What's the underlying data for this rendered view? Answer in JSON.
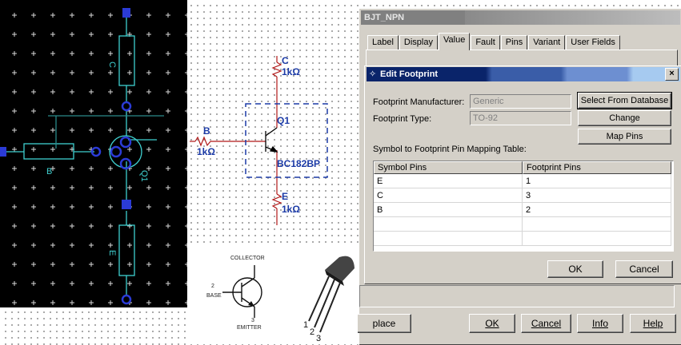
{
  "pcb": {
    "labels": [
      "C",
      "B",
      "Q1",
      "E"
    ]
  },
  "schematic": {
    "collector_name": "C",
    "collector_value": "1kΩ",
    "base_name": "B",
    "base_value": "1kΩ",
    "transistor_ref": "Q1",
    "transistor_part": "BC182BP",
    "emitter_name": "E",
    "emitter_value": "1kΩ"
  },
  "pinout": {
    "collector": "COLLECTOR",
    "base_num": "2",
    "base": "BASE",
    "emitter_num": "3",
    "emitter": "EMITTER",
    "pin_numbers": [
      "1",
      "2",
      "3"
    ]
  },
  "back_dialog": {
    "title": "BJT_NPN",
    "tabs": [
      {
        "label": "Label",
        "active": false
      },
      {
        "label": "Display",
        "active": false
      },
      {
        "label": "Value",
        "active": true
      },
      {
        "label": "Fault",
        "active": false
      },
      {
        "label": "Pins",
        "active": false
      },
      {
        "label": "Variant",
        "active": false
      },
      {
        "label": "User Fields",
        "active": false
      }
    ],
    "replace_partial": "place",
    "ok_label": "OK",
    "cancel_label": "Cancel",
    "info_label": "Info",
    "help_label": "Help"
  },
  "edit_footprint": {
    "title": "Edit Footprint",
    "close": "×",
    "manufacturer_label": "Footprint Manufacturer:",
    "manufacturer_value": "Generic",
    "type_label": "Footprint Type:",
    "type_value": "TO-92",
    "select_db_label": "Select From Database",
    "change_label": "Change",
    "map_pins_label": "Map Pins",
    "table_label": "Symbol to Footprint Pin Mapping Table:",
    "table": {
      "columns": [
        "Symbol Pins",
        "Footprint Pins"
      ],
      "rows": [
        [
          "E",
          "1"
        ],
        [
          "C",
          "3"
        ],
        [
          "B",
          "2"
        ],
        [
          "",
          ""
        ],
        [
          "",
          ""
        ]
      ]
    },
    "ok_label": "OK",
    "cancel_label": "Cancel"
  },
  "colors": {
    "pcb_bg": "#000000",
    "pcb_cyan": "#3fd0d0",
    "pcb_blue": "#2b3bd6",
    "schematic_wire": "#b01818",
    "schematic_text": "#1b3aa6",
    "titlebar_blue": "#0a246a",
    "dialog_gray": "#d4d0c8"
  }
}
